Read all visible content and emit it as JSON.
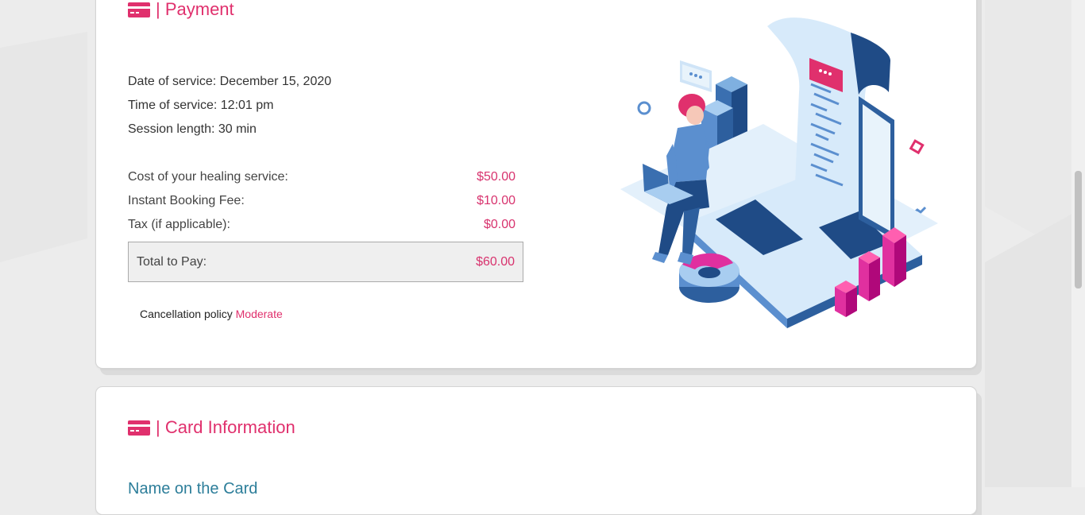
{
  "payment": {
    "title": "| Payment",
    "date_of_service_label": "Date of service:",
    "date_of_service_value": "December 15, 2020",
    "time_of_service_label": "Time of service:",
    "time_of_service_value": "12:01 pm",
    "session_length_label": "Session length:",
    "session_length_value": "30 min",
    "costs": [
      {
        "label": "Cost of your healing service:",
        "amount": "$50.00"
      },
      {
        "label": "Instant Booking Fee:",
        "amount": "$10.00"
      },
      {
        "label": "Tax (if applicable):",
        "amount": "$0.00"
      }
    ],
    "total_label": "Total to Pay:",
    "total_amount": "$60.00",
    "cancellation_label": "Cancellation policy",
    "cancellation_value": "Moderate"
  },
  "card_information": {
    "title": "| Card Information",
    "partial_field_label": "Name on the Card"
  },
  "colors": {
    "accent": "#e0306d",
    "page_background": "#ececec",
    "total_box_background": "#efefef"
  },
  "icons": {
    "section_icon": "credit-card-icon"
  }
}
